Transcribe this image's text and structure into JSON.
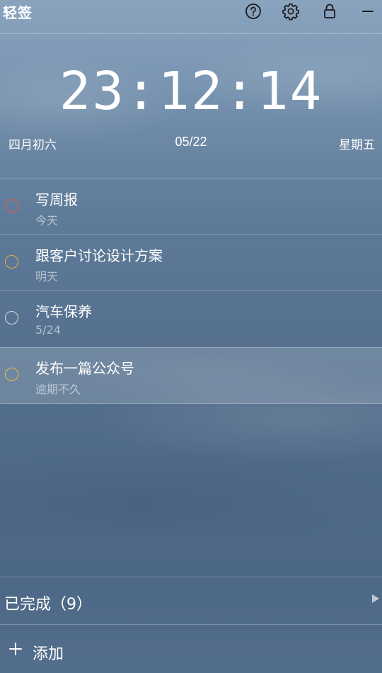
{
  "app": {
    "title": "轻签"
  },
  "toolbar": {
    "help_icon": "question-circle-icon",
    "settings_icon": "gear-icon",
    "lock_icon": "lock-icon",
    "minimize_icon": "minus-icon"
  },
  "clock": {
    "time": "23:12:14",
    "lunar_date": "四月初六",
    "date": "05/22",
    "weekday": "星期五"
  },
  "tasks": [
    {
      "title": "写周报",
      "due": "今天",
      "circle_color": "#e05a4f"
    },
    {
      "title": "跟客户讨论设计方案",
      "due": "明天",
      "circle_color": "#e6b04a"
    },
    {
      "title": "汽车保养",
      "due": "5/24",
      "circle_color": "#dcdcdc"
    },
    {
      "title": "发布一篇公众号",
      "due": "逾期不久",
      "circle_color": "#e6c04a"
    }
  ],
  "completed": {
    "label": "已完成（9）"
  },
  "add": {
    "label": "添加"
  },
  "colors": {
    "background_top": "#8aa4bf",
    "background_bottom": "#4d6886",
    "text": "#ffffff"
  }
}
